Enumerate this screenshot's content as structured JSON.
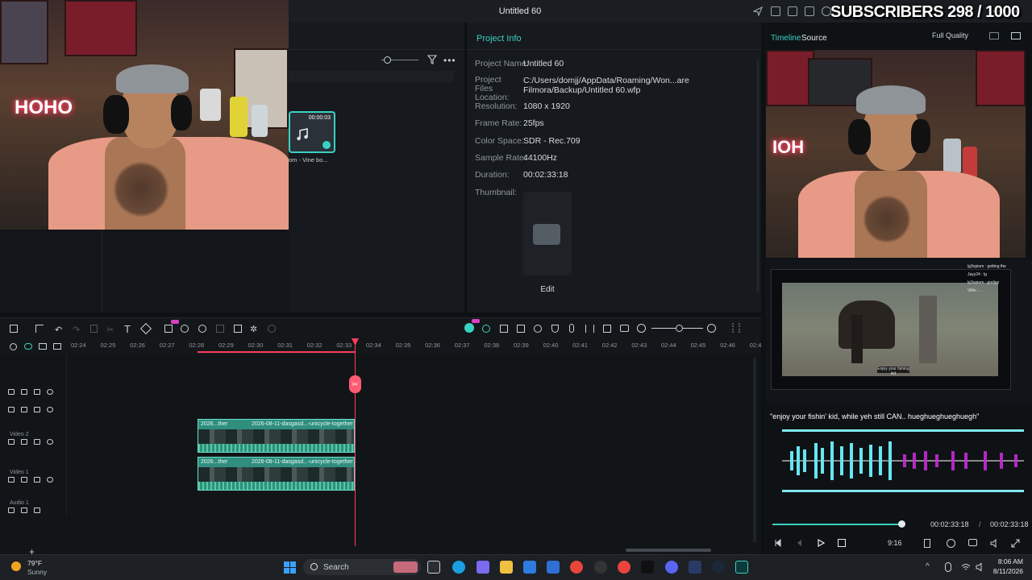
{
  "window": {
    "title": "Untitled 60"
  },
  "overlay": {
    "subscribers": "SUBSCRIBERS 298 / 1000",
    "neon_sign": "HOHO"
  },
  "project_info": {
    "tab": "Project Info",
    "rows": [
      {
        "label": "Project Name:",
        "value": "Untitled 60"
      },
      {
        "label": "Project Files Location:",
        "value": "C:/Users/domjj/AppData/Roaming/Won...are Filmora/Backup/Untitled 60.wfp"
      },
      {
        "label": "Resolution:",
        "value": "1080 x 1920"
      },
      {
        "label": "Frame Rate:",
        "value": "25fps"
      },
      {
        "label": "Color Space:",
        "value": "SDR - Rec.709"
      },
      {
        "label": "Sample Rate:",
        "value": "44100Hz"
      },
      {
        "label": "Duration:",
        "value": "00:02:33:18"
      },
      {
        "label": "Thumbnail:",
        "value": ""
      }
    ],
    "edit_button": "Edit"
  },
  "media": {
    "clip_duration": "00:00:03",
    "clip_name": "om - Vine bo..."
  },
  "player": {
    "tabs": [
      "Timeline",
      "Source"
    ],
    "quality": "Full Quality",
    "caption": "\"enjoy your fishin' kid, while yeh still CAN.. hueghueghueghuegh\"",
    "current_time": "00:02:33:18",
    "separator": "/",
    "total_time": "00:02:33:18",
    "aspect": "9:16",
    "progress": 0.98
  },
  "chat": {
    "lines": [
      "lg3opium : getting the",
      "Jayy24 : lg",
      "lg3opium : godigy",
      "Villin : ..."
    ],
    "game_subtitle": "Enjoy your fishing kid"
  },
  "timeline": {
    "ruler": [
      "02:24",
      "02:25",
      "02:26",
      "02:27",
      "02:28",
      "02:29",
      "02:30",
      "02:31",
      "02:32",
      "02:33",
      "02:34",
      "02:35",
      "02:36",
      "02:37",
      "02:38",
      "02:39",
      "02:40",
      "02:41",
      "02:42",
      "02:43",
      "02:44",
      "02:45",
      "02:46",
      "02:4"
    ],
    "tracks": [
      "",
      "",
      "Video 2",
      "Video 1",
      "Audio 1"
    ],
    "clips": [
      {
        "label_a": "2026...ther",
        "label_b": "2026-08-11-dasgasd...-unicycle-together"
      },
      {
        "label_a": "2026...ther",
        "label_b": "2026-08-11-dasgasd...-unicycle-together"
      }
    ]
  },
  "taskbar": {
    "weather_temp": "79°F",
    "weather_desc": "Sunny",
    "search": "Search",
    "time": "8:06 AM",
    "date": "8/11/2026"
  },
  "colors": {
    "accent": "#3ad1c2",
    "playhead": "#ff3b5c",
    "clip": "#2f8e7e"
  }
}
